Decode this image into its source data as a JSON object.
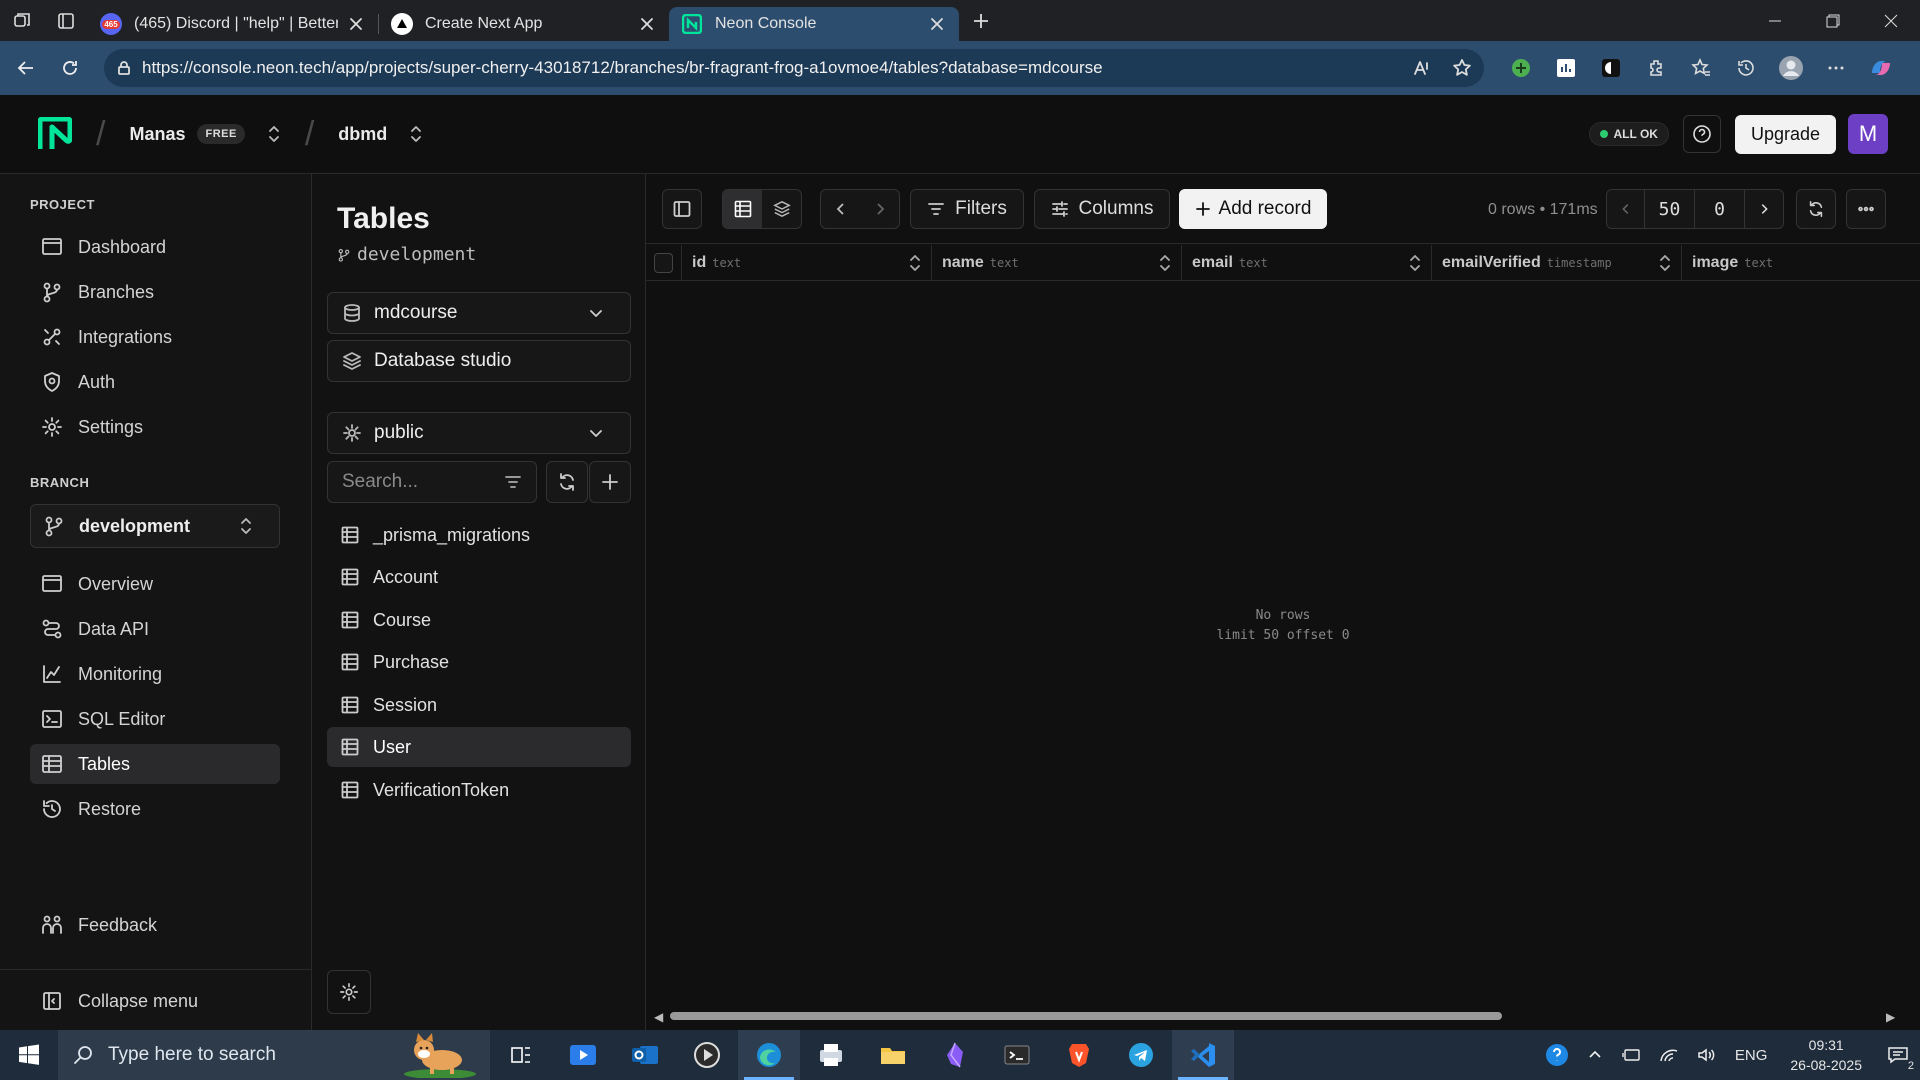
{
  "browser": {
    "tabs": [
      {
        "title": "(465) Discord | \"help\" | Better Aut",
        "badge": "465"
      },
      {
        "title": "Create Next App"
      },
      {
        "title": "Neon Console"
      }
    ],
    "url": "https://console.neon.tech/app/projects/super-cherry-43018712/branches/br-fragrant-frog-a1ovmoe4/tables?database=mdcourse"
  },
  "header": {
    "project": "Manas",
    "plan": "FREE",
    "database": "dbmd",
    "status": "ALL OK",
    "upgrade_label": "Upgrade",
    "avatar_letter": "M"
  },
  "sidebar": {
    "project_title": "PROJECT",
    "project_items": [
      {
        "label": "Dashboard",
        "icon": "dashboard-icon"
      },
      {
        "label": "Branches",
        "icon": "branch-icon"
      },
      {
        "label": "Integrations",
        "icon": "integrations-icon"
      },
      {
        "label": "Auth",
        "icon": "auth-icon"
      },
      {
        "label": "Settings",
        "icon": "gear-icon"
      }
    ],
    "branch_title": "BRANCH",
    "branch": "development",
    "branch_items": [
      {
        "label": "Overview",
        "icon": "overview-icon"
      },
      {
        "label": "Data API",
        "icon": "data-api-icon"
      },
      {
        "label": "Monitoring",
        "icon": "monitoring-icon"
      },
      {
        "label": "SQL Editor",
        "icon": "sql-editor-icon"
      },
      {
        "label": "Tables",
        "icon": "table-icon",
        "active": true
      },
      {
        "label": "Restore",
        "icon": "restore-icon"
      }
    ],
    "feedback": "Feedback",
    "collapse": "Collapse menu"
  },
  "tables_panel": {
    "title": "Tables",
    "branch": "development",
    "database": "mdcourse",
    "studio": "Database studio",
    "schema": "public",
    "search_placeholder": "Search...",
    "tables": [
      "_prisma_migrations",
      "Account",
      "Course",
      "Purchase",
      "Session",
      "User",
      "VerificationToken"
    ],
    "active_table": "User"
  },
  "toolbar": {
    "filters": "Filters",
    "columns": "Columns",
    "add_record": "Add record",
    "rows_info": "0 rows • 171ms",
    "limit": "50",
    "offset": "0"
  },
  "grid": {
    "columns": [
      {
        "name": "id",
        "type": "text"
      },
      {
        "name": "name",
        "type": "text"
      },
      {
        "name": "email",
        "type": "text"
      },
      {
        "name": "emailVerified",
        "type": "timestamp"
      },
      {
        "name": "image",
        "type": "text"
      }
    ],
    "empty_line1": "No rows",
    "empty_line2": "limit 50 offset 0"
  },
  "taskbar": {
    "search_placeholder": "Type here to search",
    "lang": "ENG",
    "time": "09:31",
    "date": "26-08-2025",
    "notif_count": "2"
  },
  "colors": {
    "neon_green": "#00e599",
    "upgrade_bg": "#f2f2f2",
    "avatar": "#6c3fc4",
    "status_dot": "#2ecc71"
  }
}
